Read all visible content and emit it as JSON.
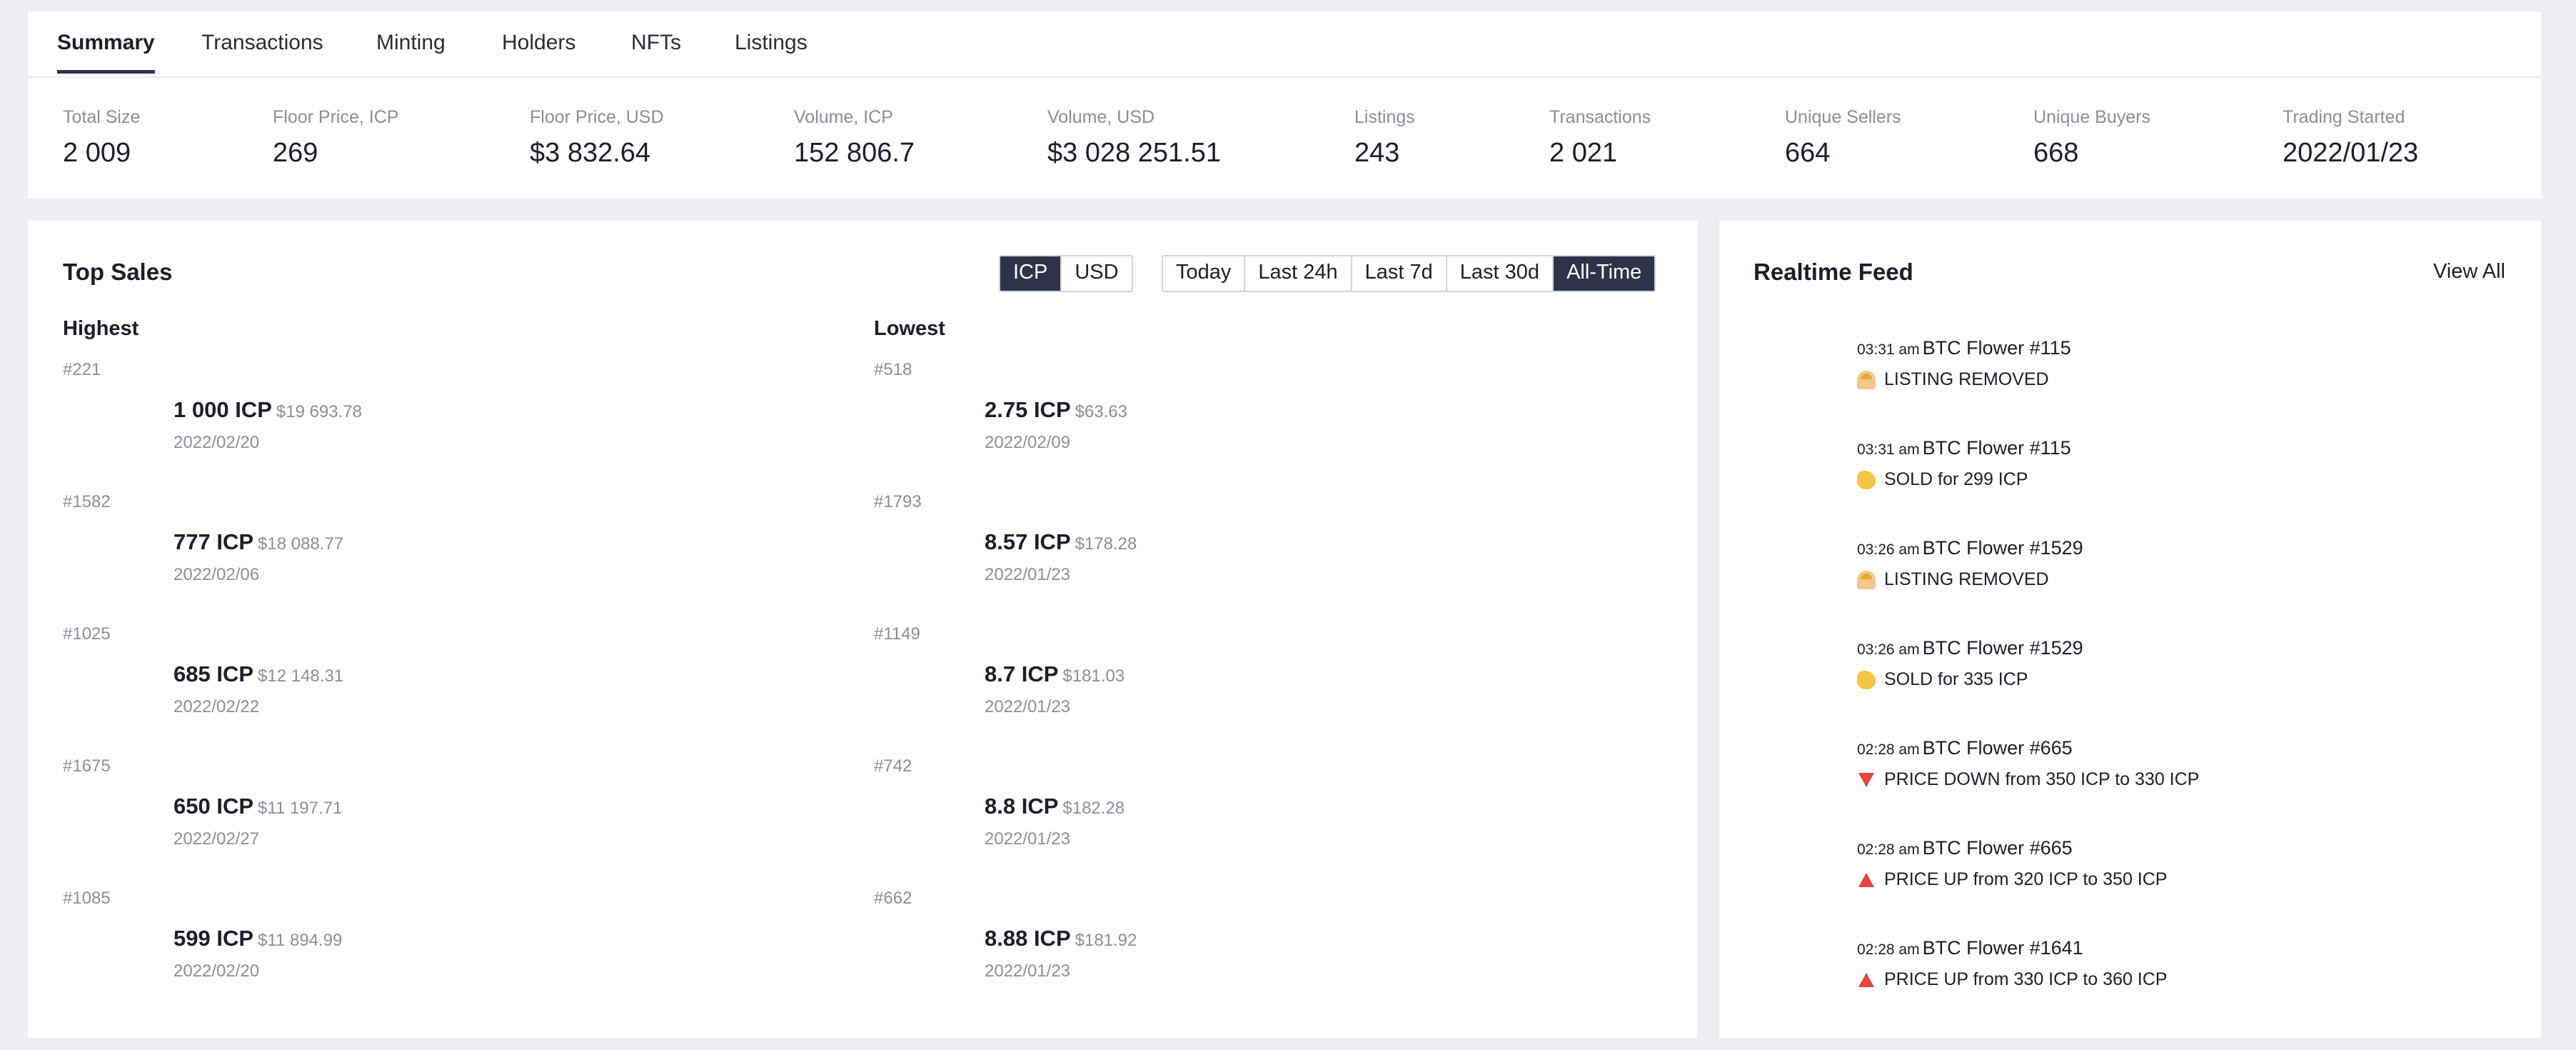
{
  "tabs": [
    {
      "label": "Summary",
      "active": true
    },
    {
      "label": "Transactions"
    },
    {
      "label": "Minting"
    },
    {
      "label": "Holders"
    },
    {
      "label": "NFTs"
    },
    {
      "label": "Listings"
    }
  ],
  "stats": [
    {
      "label": "Total Size",
      "value": "2 009"
    },
    {
      "label": "Floor Price, ICP",
      "value": "269"
    },
    {
      "label": "Floor Price, USD",
      "value": "$3 832.64"
    },
    {
      "label": "Volume, ICP",
      "value": "152 806.7"
    },
    {
      "label": "Volume, USD",
      "value": "$3 028 251.51"
    },
    {
      "label": "Listings",
      "value": "243"
    },
    {
      "label": "Transactions",
      "value": "2 021"
    },
    {
      "label": "Unique Sellers",
      "value": "664"
    },
    {
      "label": "Unique Buyers",
      "value": "668"
    },
    {
      "label": "Trading Started",
      "value": "2022/01/23"
    }
  ],
  "top_sales": {
    "title": "Top Sales",
    "currency_toggle": [
      {
        "label": "ICP",
        "active": true
      },
      {
        "label": "USD"
      }
    ],
    "range_toggle": [
      {
        "label": "Today"
      },
      {
        "label": "Last 24h"
      },
      {
        "label": "Last 7d"
      },
      {
        "label": "Last 30d"
      },
      {
        "label": "All-Time",
        "active": true
      }
    ],
    "highest_label": "Highest",
    "lowest_label": "Lowest",
    "highest": [
      {
        "id": "#221",
        "price": "1 000 ICP",
        "usd": "$19 693.78",
        "date": "2022/02/20"
      },
      {
        "id": "#1582",
        "price": "777 ICP",
        "usd": "$18 088.77",
        "date": "2022/02/06"
      },
      {
        "id": "#1025",
        "price": "685 ICP",
        "usd": "$12 148.31",
        "date": "2022/02/22"
      },
      {
        "id": "#1675",
        "price": "650 ICP",
        "usd": "$11 197.71",
        "date": "2022/02/27"
      },
      {
        "id": "#1085",
        "price": "599 ICP",
        "usd": "$11 894.99",
        "date": "2022/02/20"
      }
    ],
    "lowest": [
      {
        "id": "#518",
        "price": "2.75 ICP",
        "usd": "$63.63",
        "date": "2022/02/09"
      },
      {
        "id": "#1793",
        "price": "8.57 ICP",
        "usd": "$178.28",
        "date": "2022/01/23"
      },
      {
        "id": "#1149",
        "price": "8.7 ICP",
        "usd": "$181.03",
        "date": "2022/01/23"
      },
      {
        "id": "#742",
        "price": "8.8 ICP",
        "usd": "$182.28",
        "date": "2022/01/23"
      },
      {
        "id": "#662",
        "price": "8.88 ICP",
        "usd": "$181.92",
        "date": "2022/01/23"
      }
    ]
  },
  "feed": {
    "title": "Realtime Feed",
    "view_all": "View All",
    "items": [
      {
        "time": "03:31 am",
        "name": "BTC Flower #115",
        "icon": "listing-removed-icon",
        "event": "LISTING REMOVED"
      },
      {
        "time": "03:31 am",
        "name": "BTC Flower #115",
        "icon": "sold-icon",
        "event": "SOLD for 299 ICP"
      },
      {
        "time": "03:26 am",
        "name": "BTC Flower #1529",
        "icon": "listing-removed-icon",
        "event": "LISTING REMOVED"
      },
      {
        "time": "03:26 am",
        "name": "BTC Flower #1529",
        "icon": "sold-icon",
        "event": "SOLD for 335 ICP"
      },
      {
        "time": "02:28 am",
        "name": "BTC Flower #665",
        "icon": "price-down-icon",
        "event": "PRICE DOWN from 350 ICP to 330 ICP"
      },
      {
        "time": "02:28 am",
        "name": "BTC Flower #665",
        "icon": "price-up-icon",
        "event": "PRICE UP from 320 ICP to 350 ICP"
      },
      {
        "time": "02:28 am",
        "name": "BTC Flower #1641",
        "icon": "price-up-icon",
        "event": "PRICE UP from 330 ICP to 360 ICP"
      }
    ]
  },
  "colors": {
    "accent_dark": "#2f3349",
    "muted_text": "#8a8e99",
    "price_arrow": "#e2453c",
    "page_bg": "#eceef2"
  }
}
